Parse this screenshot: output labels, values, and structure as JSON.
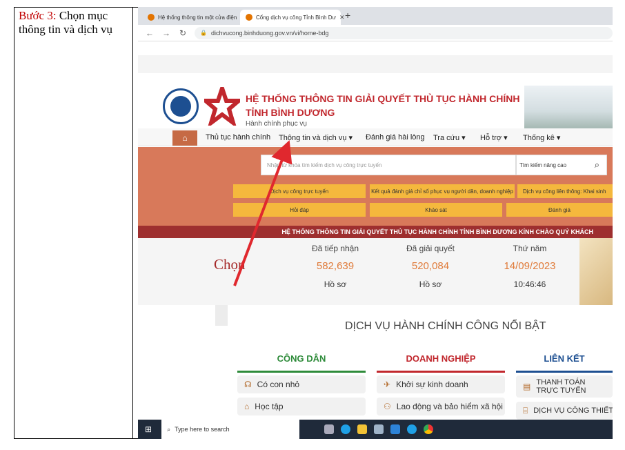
{
  "document": {
    "step_label": "Bước 3:",
    "step_text": "Chọn mục thông tin và dịch vụ"
  },
  "browser": {
    "tabs": [
      {
        "title": "Hệ thống thông tin một cửa điện"
      },
      {
        "title": "Cổng dịch vụ công Tỉnh Bình Dư"
      }
    ],
    "url": "dichvucong.binhduong.gov.vn/vi/home-bdg"
  },
  "site": {
    "title_line1": "HỆ THỐNG THÔNG TIN GIẢI QUYẾT THỦ TỤC HÀNH CHÍNH",
    "title_line2": "TỈNH BÌNH DƯƠNG",
    "subtitle": "Hành chính phục vụ",
    "menu": [
      "Thủ tục hành chính",
      "Thông tin và dịch vụ ▾",
      "Đánh giá hài lòng",
      "Tra cứu ▾",
      "Hỗ trợ ▾",
      "Thống kê ▾"
    ],
    "search_placeholder": "Nhập từ khóa tìm kiếm dịch vụ công trực tuyến",
    "advanced_search": "Tìm kiếm nâng cao",
    "quick_links": [
      "Dịch vụ công trực tuyến",
      "Kết quả đánh giá chỉ số phục vụ người dân, doanh nghiệp",
      "Dịch vụ công liên thông: Khai sinh",
      "Hỏi đáp",
      "Khảo sát",
      "Đánh giá"
    ],
    "marquee": "HỆ THỐNG THÔNG TIN GIẢI QUYẾT THỦ TỤC HÀNH CHÍNH TỈNH BÌNH DƯƠNG KÍNH CHÀO QUÝ KHÁCH",
    "annotation": "Chọn",
    "stats": [
      {
        "label": "Đã tiếp nhận",
        "value": "582,639",
        "unit": "Hồ sơ"
      },
      {
        "label": "Đã giải quyết",
        "value": "520,084",
        "unit": "Hồ sơ"
      },
      {
        "label": "Thứ năm",
        "value": "14/09/2023",
        "unit": "10:46:46"
      }
    ],
    "services_title": "DỊCH VỤ HÀNH CHÍNH CÔNG NỔI BẬT",
    "columns": [
      {
        "title": "CÔNG DÂN",
        "color": "#2e8b3a",
        "items": [
          "Có con nhỏ",
          "Học tập"
        ]
      },
      {
        "title": "DOANH NGHIỆP",
        "color": "#c1272d",
        "items": [
          "Khởi sự kinh doanh",
          "Lao động và bảo hiểm xã hội"
        ]
      },
      {
        "title": "LIÊN KẾT",
        "color": "#1d4f91",
        "items": [
          "THANH TOÁN TRỰC TUYẾN",
          "DỊCH VỤ CÔNG THIẾT"
        ]
      }
    ]
  },
  "taskbar": {
    "search_placeholder": "Type here to search"
  },
  "colors": {
    "accent_red": "#e0282e",
    "brand_red": "#c1272d",
    "banner": "#d8795a",
    "quick_button": "#f5b83d"
  }
}
